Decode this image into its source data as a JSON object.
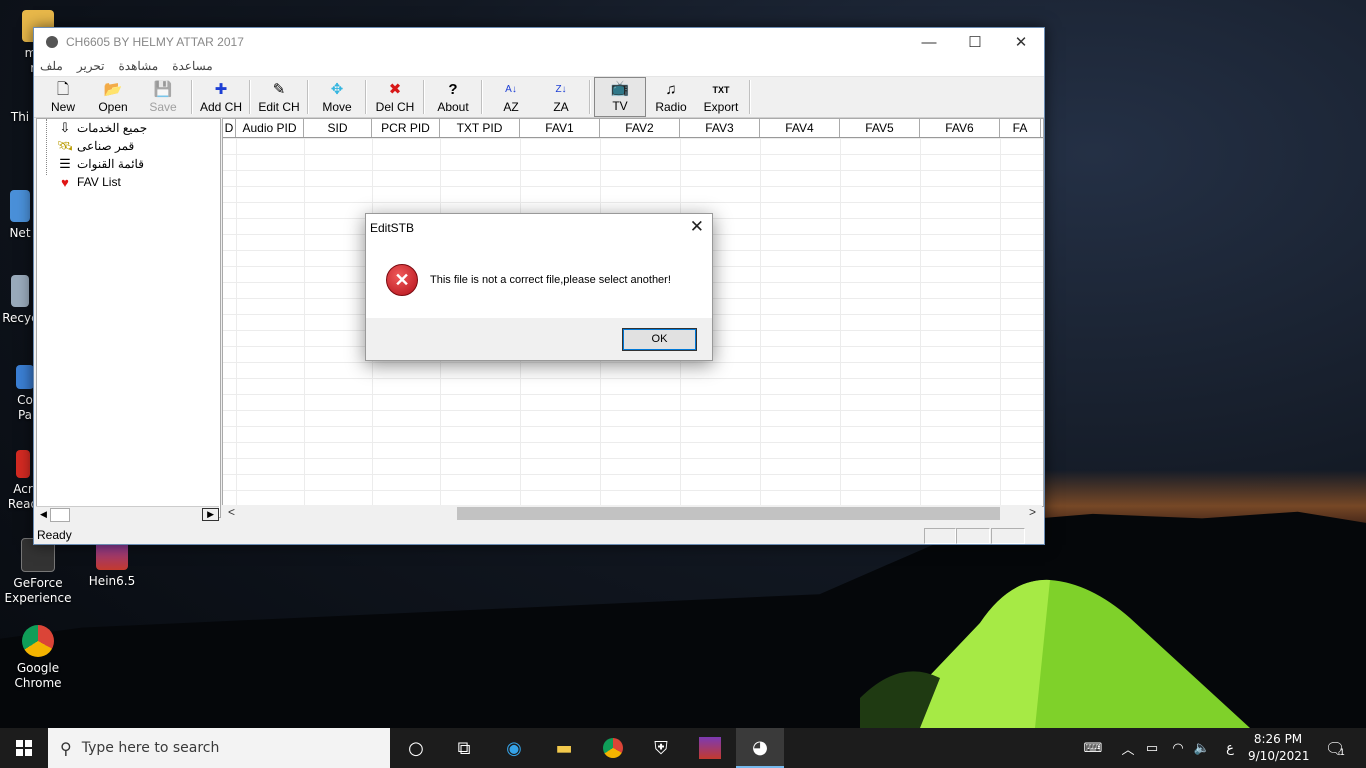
{
  "desktop": {
    "icons": [
      {
        "label": "moh\nrai",
        "name": "desktop-icon-mohrai"
      },
      {
        "label": "Thi",
        "name": "desktop-icon-this-pc"
      },
      {
        "label": "Net",
        "name": "desktop-icon-network"
      },
      {
        "label": "Recyc",
        "name": "desktop-icon-recycle-bin"
      },
      {
        "label": "Co\nPa",
        "name": "desktop-icon-control-panel"
      },
      {
        "label": "Acr\nRead",
        "name": "desktop-icon-acrobat-reader"
      },
      {
        "label": "GeForce\nExperience",
        "name": "desktop-icon-geforce"
      },
      {
        "label": "Hein6.5",
        "name": "desktop-icon-hein"
      },
      {
        "label": "Google\nChrome",
        "name": "desktop-icon-chrome"
      }
    ]
  },
  "window": {
    "title": "CH6605 BY HELMY ATTAR 2017",
    "min_glyph": "—",
    "max_glyph": "☐",
    "close_glyph": "✕",
    "menu": [
      "ملف",
      "تحرير",
      "مشاهدة",
      "مساعدة"
    ],
    "toolbar": [
      {
        "label": "New",
        "icon": "new-file-icon",
        "glyph": "🗋"
      },
      {
        "label": "Open",
        "icon": "open-folder-icon",
        "glyph": "📂"
      },
      {
        "label": "Save",
        "icon": "save-icon",
        "glyph": "💾"
      },
      {
        "label": "Add CH",
        "icon": "add-icon",
        "glyph": "✚"
      },
      {
        "label": "Edit CH",
        "icon": "edit-icon",
        "glyph": "✎"
      },
      {
        "label": "Move",
        "icon": "move-icon",
        "glyph": "✥"
      },
      {
        "label": "Del CH",
        "icon": "delete-icon",
        "glyph": "✖"
      },
      {
        "label": "About",
        "icon": "help-icon",
        "glyph": "?"
      },
      {
        "label": "AZ",
        "icon": "sort-az-icon",
        "glyph": "A↓"
      },
      {
        "label": "ZA",
        "icon": "sort-za-icon",
        "glyph": "Z↓"
      },
      {
        "label": "TV",
        "icon": "tv-icon",
        "glyph": "📺"
      },
      {
        "label": "Radio",
        "icon": "music-icon",
        "glyph": "♫"
      },
      {
        "label": "Export",
        "icon": "export-icon",
        "glyph": "TXT"
      }
    ],
    "tree": [
      {
        "label": "جميع الخدمات",
        "icon": "arrow-down-icon",
        "glyph": "⇩"
      },
      {
        "label": "قمر صناعى",
        "icon": "satellite-icon",
        "glyph": "🛰"
      },
      {
        "label": "قائمة القنوات",
        "icon": "list-icon",
        "glyph": "☰"
      },
      {
        "label": "FAV List",
        "icon": "heart-icon",
        "glyph": "♥"
      }
    ],
    "columns": [
      "D",
      "Audio PID",
      "SID",
      "PCR PID",
      "TXT PID",
      "FAV1",
      "FAV2",
      "FAV3",
      "FAV4",
      "FAV5",
      "FAV6",
      "FA"
    ],
    "status": "Ready",
    "scroll_left_glyph": "◀",
    "scroll_right_glyph": "▶",
    "hscroll_left_glyph": "<",
    "hscroll_right_glyph": ">"
  },
  "dialog": {
    "title": "EditSTB",
    "close_glyph": "✕",
    "error_glyph": "✕",
    "message": "This file is not a correct file,please select another!",
    "ok_label": "OK"
  },
  "taskbar": {
    "search_placeholder": "Type here to search",
    "time": "8:26 PM",
    "date": "9/10/2021",
    "language": "ع",
    "notification_count": "1"
  }
}
